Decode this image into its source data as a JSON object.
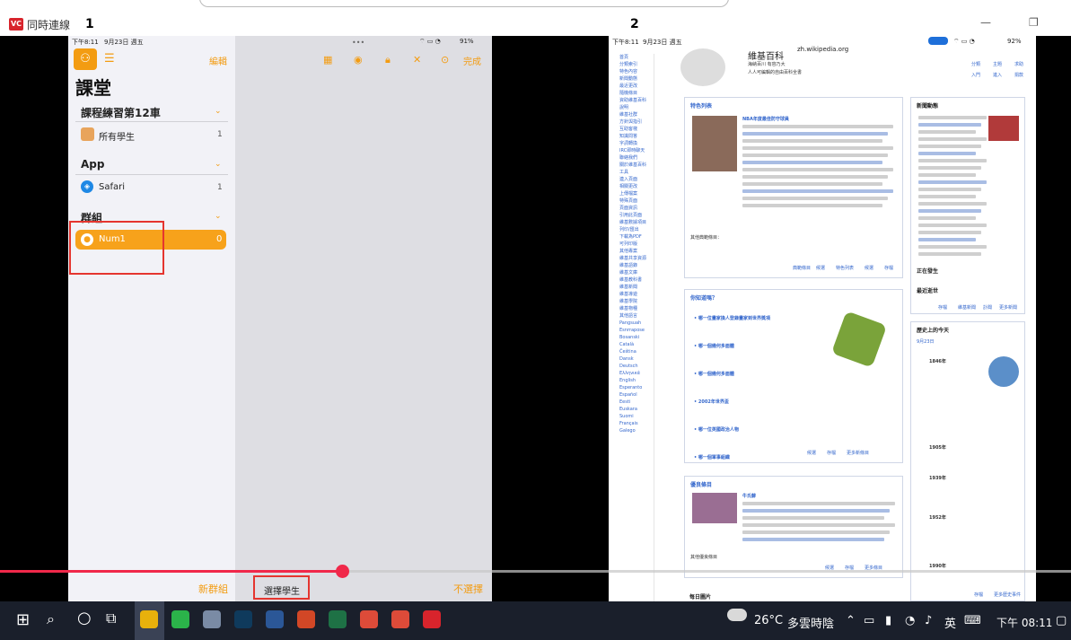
{
  "window": {
    "app_title": "同時連線",
    "app_icon": "app-logo-icon",
    "marker_left": "1",
    "marker_right": "2"
  },
  "left_ipad": {
    "status_time": "下午8:11",
    "status_date": "9月23日 週五",
    "status_battery": "91%",
    "edit_label": "編輯",
    "done_label": "完成",
    "page_title": "課堂",
    "sections": [
      {
        "title": "課程練習第12車",
        "items": [
          {
            "label": "所有學生",
            "count": "1",
            "icon": "students-icon"
          }
        ]
      },
      {
        "title": "App",
        "items": [
          {
            "label": "Safari",
            "count": "1",
            "icon": "safari-icon"
          }
        ]
      },
      {
        "title": "群組",
        "items": [
          {
            "label": "Num1",
            "count": "0",
            "icon": "person-icon"
          }
        ]
      }
    ],
    "new_group_label": "新群組",
    "select_students_label": "選擇學生",
    "deselect_label": "不選擇"
  },
  "right_ipad": {
    "status_time": "下午8:11",
    "status_date": "9月23日 週五",
    "status_battery": "92%",
    "url": "zh.wikipedia.org",
    "wiki_title": "維基百科",
    "wiki_sub1": "海納百川 有容乃大",
    "wiki_sub2": "人人可編輯的自由百科全書",
    "top_links": [
      "分類",
      "主題",
      "求助",
      "入門",
      "進入",
      "捐款"
    ],
    "featured_heading": "特色列表",
    "featured_lead": "NBA年度最佳防守球員",
    "featured_more": "其他典範條目：",
    "featured_links": [
      "典範條目",
      "候選",
      "特色列表",
      "候選",
      "存檔"
    ],
    "dyk_heading": "你知道嗎？",
    "dyk_items": [
      "哪一位畫家換人登錄畫家到世界獎項",
      "哪一個幾何多面體",
      "哪一個幾何多面體",
      "2002年世界盃",
      "哪一位英國政治人物",
      "哪一個軍事組織",
      "哪一個幾何多面體"
    ],
    "dyk_links": [
      "候選",
      "存檔",
      "更多新條目"
    ],
    "good_heading": "優良條目",
    "good_lead": "牛氏蘚",
    "good_more": "其他優良條目",
    "good_links": [
      "候選",
      "存檔",
      "更多條目"
    ],
    "news_heading": "新聞動態",
    "news_links": [
      "存檔",
      "維基新聞",
      "訃聞",
      "更多新聞"
    ],
    "ongoing_heading": "正在發生",
    "recent_heading": "最近逝世",
    "history_heading": "歷史上的今天",
    "history_date": "9月23日",
    "history_years": [
      "1846年",
      "1905年",
      "1939年",
      "1952年",
      "1990年"
    ],
    "history_links": [
      "存檔",
      "更多歷史事件"
    ],
    "image_heading": "每日圖片",
    "side_links": [
      "首頁",
      "分類索引",
      "特色內容",
      "新聞動態",
      "最近更改",
      "隨機條目",
      "資助維基百科",
      "說明",
      "維基社群",
      "方針與指引",
      "互助客棧",
      "知識問答",
      "字詞轉換",
      "IRC即時聊天",
      "聯絡我們",
      "關於維基百科",
      "工具",
      "連入頁面",
      "相關更改",
      "上傳檔案",
      "特殊頁面",
      "頁面資訊",
      "引用此頁面",
      "維基數據項目",
      "列印/匯出",
      "下載為PDF",
      "可列印版",
      "其他專案",
      "維基共享資源",
      "維基語錄",
      "維基文庫",
      "維基教科書",
      "維基新聞",
      "維基導遊",
      "維基學院",
      "維基物種",
      "其他語言",
      "Pangsuah",
      "Esnrrapose",
      "Bosanski",
      "Català",
      "Čeština",
      "Dansk",
      "Deutsch",
      "Ελληνικά",
      "English",
      "Esperanto",
      "Español",
      "Eesti",
      "Euskara",
      "Suomi",
      "Français",
      "Galego"
    ]
  },
  "taskbar": {
    "weather_temp": "26°C",
    "weather_desc": "多雲時陰",
    "ime_label": "英",
    "clock": "下午 08:11",
    "pinned": [
      {
        "name": "file-explorer-icon",
        "color": "#e8b10c"
      },
      {
        "name": "line-icon",
        "color": "#2bb34a"
      },
      {
        "name": "notes-icon",
        "color": "#7a8ba5"
      },
      {
        "name": "screen-icon",
        "color": "#0f3a5c"
      },
      {
        "name": "word-icon",
        "color": "#2b5797"
      },
      {
        "name": "powerpoint-icon",
        "color": "#d24726"
      },
      {
        "name": "excel-icon",
        "color": "#1e7145"
      },
      {
        "name": "chrome-icon",
        "color": "#dd4b39"
      },
      {
        "name": "chrome-alt-icon",
        "color": "#dd4b39"
      },
      {
        "name": "app-icon",
        "color": "#d8242c"
      }
    ]
  },
  "video": {
    "progress": 0.32
  },
  "colors": {
    "accent": "#f39c12",
    "red_box": "#e5352f",
    "progress": "#f0284a"
  }
}
